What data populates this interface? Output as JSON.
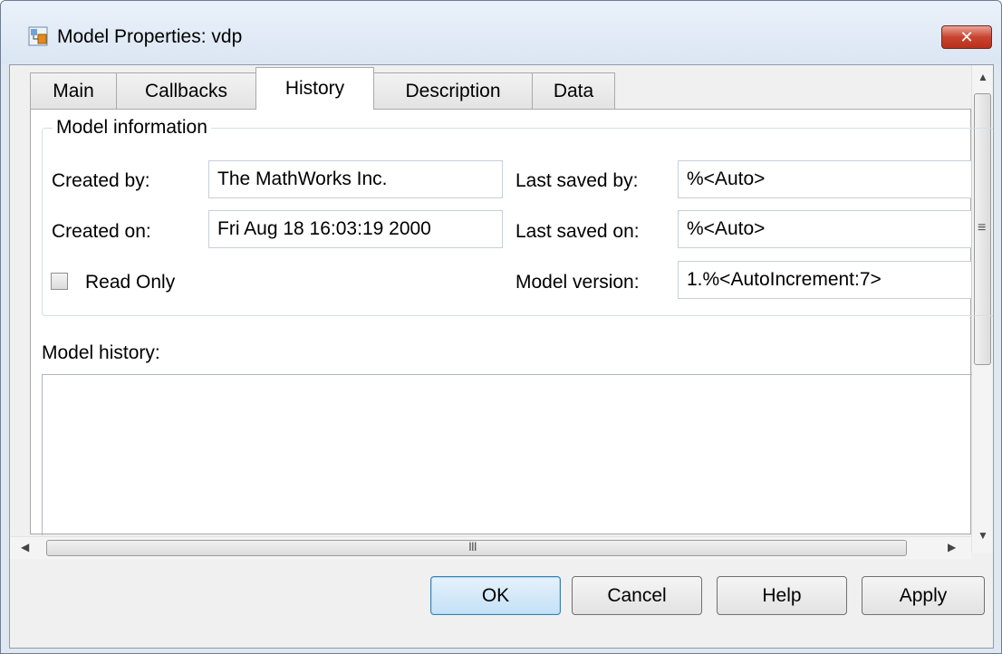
{
  "window": {
    "title": "Model Properties: vdp",
    "close_symbol": "✕"
  },
  "tabs": [
    {
      "label": "Main",
      "active": false
    },
    {
      "label": "Callbacks",
      "active": false
    },
    {
      "label": "History",
      "active": true
    },
    {
      "label": "Description",
      "active": false
    },
    {
      "label": "Data",
      "active": false
    }
  ],
  "model_information": {
    "legend": "Model information",
    "created_by_label": "Created by:",
    "created_by_value": "The MathWorks Inc.",
    "created_on_label": "Created on:",
    "created_on_value": "Fri Aug 18 16:03:19 2000",
    "read_only_label": "Read Only",
    "read_only_checked": false,
    "last_saved_by_label": "Last saved by:",
    "last_saved_by_value": "%<Auto>",
    "last_saved_on_label": "Last saved on:",
    "last_saved_on_value": "%<Auto>",
    "model_version_label": "Model version:",
    "model_version_value": "1.%<AutoIncrement:7>"
  },
  "model_history": {
    "label": "Model history:",
    "value": ""
  },
  "scrollbar": {
    "grip_vertical": "≡",
    "grip_horizontal": "III"
  },
  "buttons": {
    "ok": "OK",
    "cancel": "Cancel",
    "help": "Help",
    "apply": "Apply"
  },
  "icons": {
    "app": "simulink-model-icon",
    "close": "close-icon"
  },
  "colors": {
    "title_bar": "#dbe6f3",
    "close_button": "#c8442f",
    "default_button_border": "#3c7fb1"
  }
}
